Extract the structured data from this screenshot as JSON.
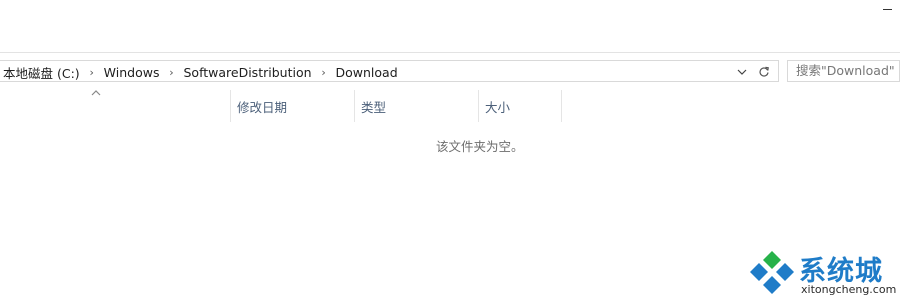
{
  "address_bar": {
    "crumbs": [
      "本地磁盘 (C:)",
      "Windows",
      "SoftwareDistribution",
      "Download"
    ]
  },
  "search": {
    "placeholder": "搜索\"Download\""
  },
  "columns": [
    {
      "label": "修改日期"
    },
    {
      "label": "类型"
    },
    {
      "label": "大小"
    }
  ],
  "empty_message": "该文件夹为空。",
  "watermark": {
    "name": "系统城",
    "url": "xitongcheng.com"
  },
  "icons": {
    "minimize": "minimize-icon",
    "separator": "chevron-right-icon",
    "dropdown": "chevron-down-icon",
    "refresh": "refresh-icon",
    "sort": "sort-caret-icon",
    "logo": "diamond-logo-icon"
  },
  "colors": {
    "brand": "#1f7cc8",
    "logo_green": "#27b24a",
    "header_text": "#4c607a"
  }
}
